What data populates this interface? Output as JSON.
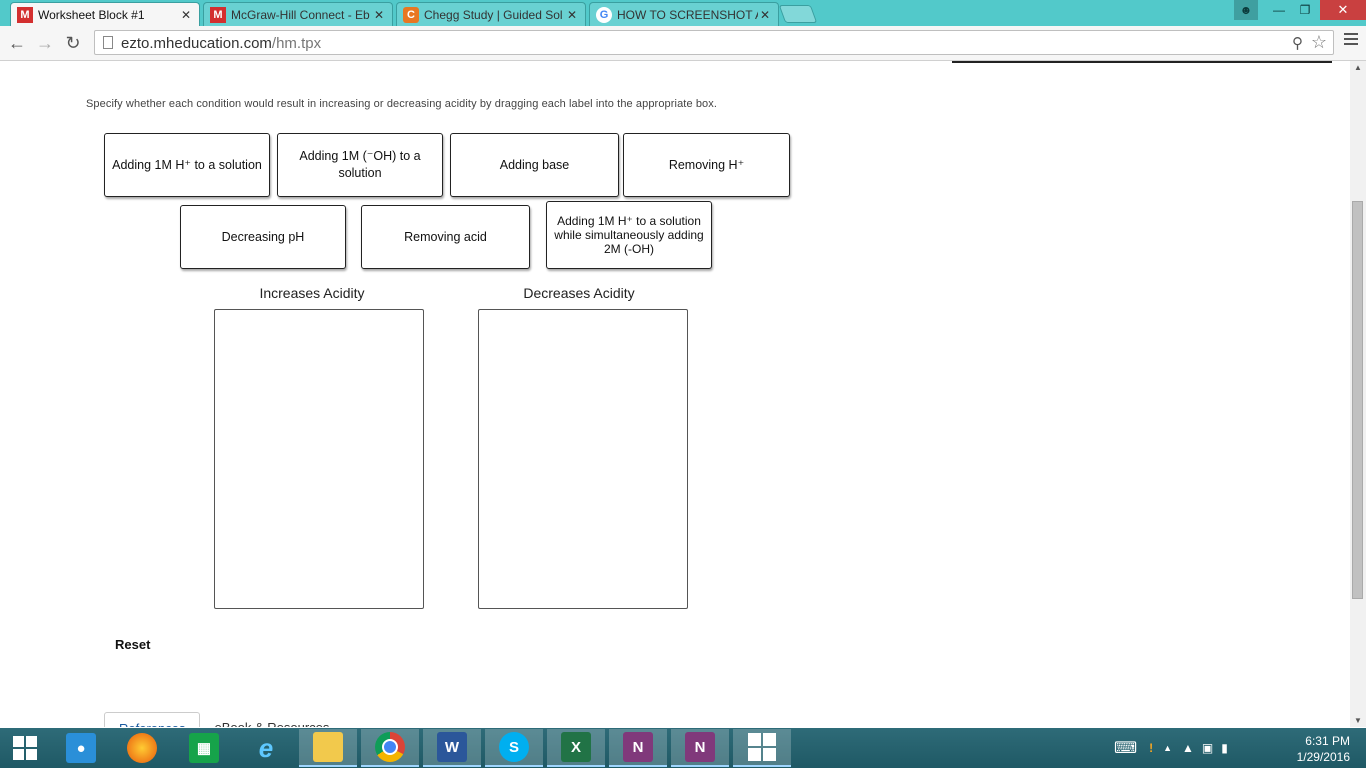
{
  "browser": {
    "tabs": [
      {
        "title": "Worksheet Block #1",
        "favicon": "M",
        "favicon_color": "#d32f2f",
        "active": true
      },
      {
        "title": "McGraw-Hill Connect - Eb",
        "favicon": "M",
        "favicon_color": "#d32f2f",
        "active": false
      },
      {
        "title": "Chegg Study | Guided Sol",
        "favicon": "C",
        "favicon_color": "#e87722",
        "active": false
      },
      {
        "title": "HOW TO SCREENSHOT AS",
        "favicon": "G",
        "favicon_color": "#4285f4",
        "active": false
      }
    ],
    "url_domain": "ezto.mheducation.com",
    "url_path": "/hm.tpx",
    "close_glyph": "✕"
  },
  "question": {
    "instructions": "Specify whether each condition would result in increasing or decreasing acidity by dragging each label into the appropriate box.",
    "labels": [
      "Adding 1M H⁺ to a solution",
      "Adding 1M (⁻OH) to a solution",
      "Adding base",
      "Removing H⁺",
      "Decreasing pH",
      "Removing acid",
      "Adding 1M H⁺ to a solution while simultaneously adding 2M (-OH)"
    ],
    "bins": [
      {
        "title": "Increases Acidity"
      },
      {
        "title": "Decreases Acidity"
      }
    ],
    "reset_label": "Reset",
    "bottom_tabs": [
      "References",
      "eBook & Resources"
    ]
  },
  "taskbar": {
    "apps": [
      "start",
      "people-hub",
      "firefox",
      "store",
      "internet-explorer",
      "file-explorer",
      "chrome",
      "word",
      "skype",
      "excel",
      "onenote",
      "onenote-clipper",
      "windows-app"
    ],
    "time": "6:31 PM",
    "date": "1/29/2016"
  }
}
